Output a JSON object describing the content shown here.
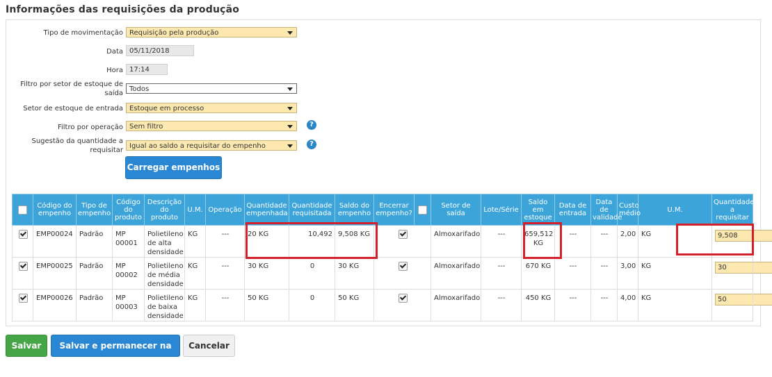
{
  "page": {
    "title": "Informações das requisições da produção"
  },
  "form": {
    "tipo_label": "Tipo de movimentação",
    "tipo_value": "Requisição pela produção",
    "data_label": "Data",
    "data_value": "05/11/2018",
    "hora_label": "Hora",
    "hora_value": "17:14",
    "filtro_setor_label": "Filtro por setor de estoque de saída",
    "filtro_setor_value": "Todos",
    "setor_entrada_label": "Setor de estoque de entrada",
    "setor_entrada_value": "Estoque em processo",
    "filtro_operacao_label": "Filtro por operação",
    "filtro_operacao_value": "Sem filtro",
    "sugestao_label": "Sugestão da quantidade a requisitar",
    "sugestao_value": "Igual ao saldo a requisitar do empenho",
    "help_glyph": "?",
    "load_button": "Carregar empenhos"
  },
  "table": {
    "headers": [
      "Código do empenho",
      "Tipo de empenho",
      "Código do produto",
      "Descrição do produto",
      "U.M.",
      "Operação",
      "Quantidade empenhada",
      "Quantidade requisitada",
      "Saldo do empenho",
      "Encerrar empenho?",
      "Setor de saída",
      "Lote/Série",
      "Saldo em estoque",
      "Data de entrada",
      "Data de validade",
      "Custo médio",
      "U.M.",
      "Quantidade a requisitar"
    ],
    "rows": [
      {
        "codigo": "EMP00024",
        "tipo": "Padrão",
        "produto": "MP 00001",
        "descricao": "Polietileno de alta densidade",
        "um": "KG",
        "operacao": "---",
        "qtd_empenhada": "20 KG",
        "qtd_requisitada": "10,492",
        "saldo_empenho": "9,508 KG",
        "setor_saida": "Almoxarifado",
        "lote": "---",
        "saldo_estoque": "659,512 KG",
        "data_entrada": "---",
        "data_validade": "---",
        "custo": "2,00",
        "um2": "KG",
        "qtd_requisitar": "9,508"
      },
      {
        "codigo": "EMP00025",
        "tipo": "Padrão",
        "produto": "MP 00002",
        "descricao": "Polietileno de média densidade",
        "um": "KG",
        "operacao": "---",
        "qtd_empenhada": "30 KG",
        "qtd_requisitada": "0",
        "saldo_empenho": "30 KG",
        "setor_saida": "Almoxarifado",
        "lote": "---",
        "saldo_estoque": "670 KG",
        "data_entrada": "---",
        "data_validade": "---",
        "custo": "3,00",
        "um2": "KG",
        "qtd_requisitar": "30"
      },
      {
        "codigo": "EMP00026",
        "tipo": "Padrão",
        "produto": "MP 00003",
        "descricao": "Polietileno de baixa densidade",
        "um": "KG",
        "operacao": "---",
        "qtd_empenhada": "50 KG",
        "qtd_requisitada": "0",
        "saldo_empenho": "50 KG",
        "setor_saida": "Almoxarifado",
        "lote": "---",
        "saldo_estoque": "450 KG",
        "data_entrada": "---",
        "data_validade": "---",
        "custo": "4,00",
        "um2": "KG",
        "qtd_requisitar": "50"
      }
    ]
  },
  "footer": {
    "save": "Salvar",
    "save_stay": "Salvar e permanecer na tela",
    "cancel": "Cancelar"
  },
  "colors": {
    "highlight": "#d3202a",
    "header": "#3ca4d9",
    "select_bg": "#fde9b0",
    "primary": "#2a87d3",
    "success": "#46a546"
  }
}
